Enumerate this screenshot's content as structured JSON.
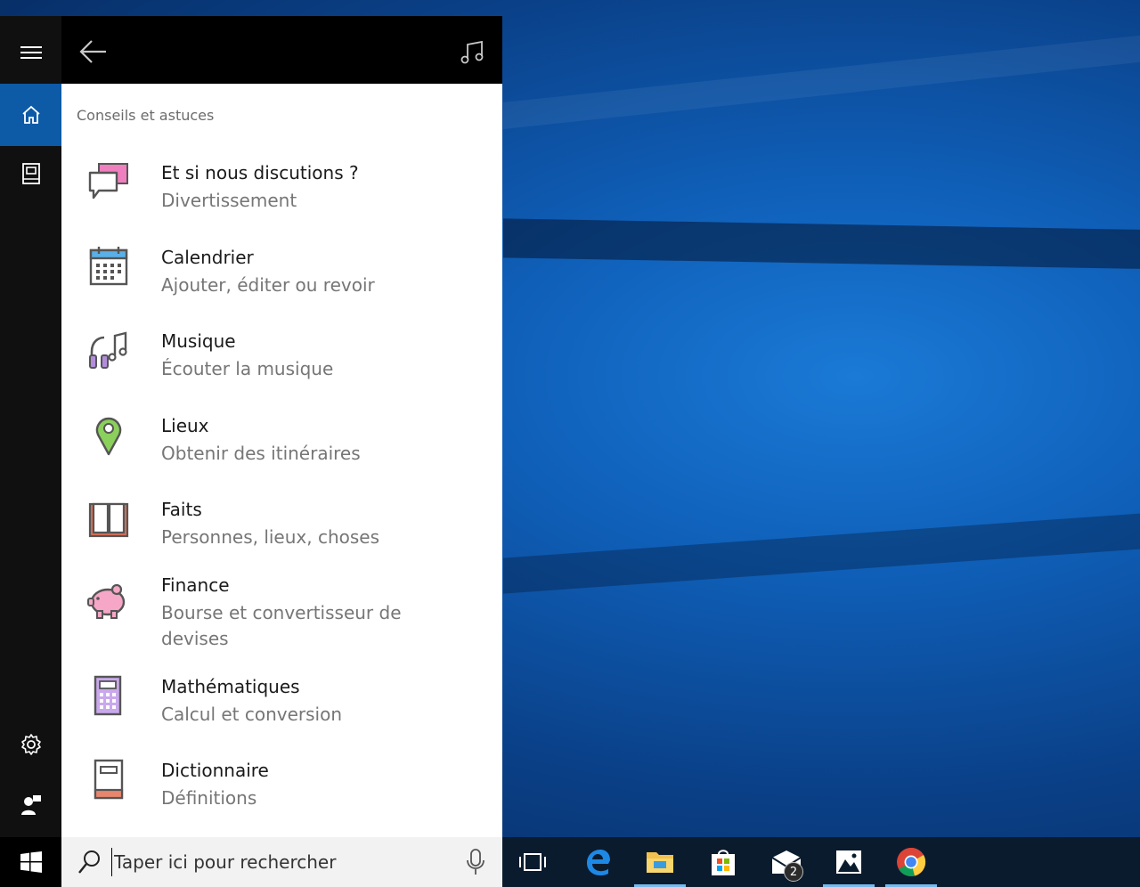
{
  "header": {
    "menu_icon": "hamburger-icon",
    "back_icon": "back-arrow-icon",
    "music_icon": "music-note-icon"
  },
  "rail": {
    "items": [
      {
        "icon": "home-icon",
        "selected": true
      },
      {
        "icon": "notebook-icon",
        "selected": false
      },
      {
        "icon": "gear-icon",
        "selected": false
      },
      {
        "icon": "feedback-icon",
        "selected": false
      }
    ],
    "accent": "#0d5aa7"
  },
  "content": {
    "section_title": "Conseils et astuces",
    "items": [
      {
        "title": "Et si nous discutions ?",
        "subtitle": "Divertissement",
        "icon": "chat-bubbles-icon"
      },
      {
        "title": "Calendrier",
        "subtitle": "Ajouter, éditer ou revoir",
        "icon": "calendar-icon"
      },
      {
        "title": "Musique",
        "subtitle": "Écouter la musique",
        "icon": "headphones-music-icon"
      },
      {
        "title": "Lieux",
        "subtitle": "Obtenir des itinéraires",
        "icon": "map-pin-icon"
      },
      {
        "title": "Faits",
        "subtitle": "Personnes, lieux, choses",
        "icon": "open-book-icon"
      },
      {
        "title": "Finance",
        "subtitle": "Bourse et convertisseur de devises",
        "icon": "piggy-bank-icon"
      },
      {
        "title": "Mathématiques",
        "subtitle": "Calcul et conversion",
        "icon": "calculator-icon"
      },
      {
        "title": "Dictionnaire",
        "subtitle": "Définitions",
        "icon": "dictionary-icon"
      }
    ]
  },
  "taskbar": {
    "search_placeholder": "Taper ici pour rechercher",
    "apps": [
      {
        "icon": "task-view-icon"
      },
      {
        "icon": "edge-icon"
      },
      {
        "icon": "file-explorer-icon"
      },
      {
        "icon": "store-icon"
      },
      {
        "icon": "mail-icon",
        "badge": "2"
      },
      {
        "icon": "photos-icon"
      },
      {
        "icon": "chrome-icon"
      }
    ]
  }
}
